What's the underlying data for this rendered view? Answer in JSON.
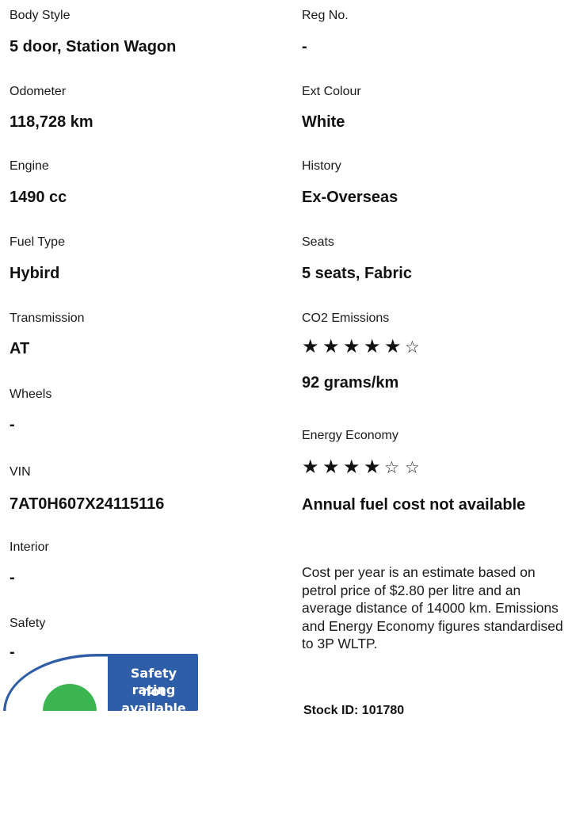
{
  "left": {
    "body_style": {
      "label": "Body Style",
      "value": "5 door, Station Wagon"
    },
    "odometer": {
      "label": "Odometer",
      "value": "118,728 km"
    },
    "engine": {
      "label": "Engine",
      "value": "1490 cc"
    },
    "fuel_type": {
      "label": "Fuel Type",
      "value": "Hybird"
    },
    "transmission": {
      "label": "Transmission",
      "value": "AT"
    },
    "wheels": {
      "label": "Wheels",
      "value": "-"
    },
    "vin": {
      "label": "VIN",
      "value": "7AT0H607X24115116"
    },
    "interior": {
      "label": "Interior",
      "value": "-"
    },
    "safety": {
      "label": "Safety",
      "value": "-",
      "badge_line1": "Safety rating",
      "badge_line2": "not available"
    }
  },
  "right": {
    "reg_no": {
      "label": "Reg No.",
      "value": "-"
    },
    "ext_colour": {
      "label": "Ext Colour",
      "value": "White"
    },
    "history": {
      "label": "History",
      "value": "Ex-Overseas"
    },
    "seats": {
      "label": "Seats",
      "value": "5 seats, Fabric"
    },
    "co2": {
      "label": "CO2 Emissions",
      "rating": 5,
      "max_rating": 6,
      "value": "92 grams/km"
    },
    "energy": {
      "label": "Energy Economy",
      "rating": 4,
      "max_rating": 6,
      "value": "Annual fuel cost not available"
    },
    "note": "Cost per year is an estimate based on petrol price of  $2.80 per litre and an average distance of 14000 km. Emissions and Energy Economy figures standardised to 3P WLTP.",
    "stock_id": "Stock ID: 101780"
  },
  "colors": {
    "badge_blue": "#2f5ea8",
    "badge_green": "#3cb551",
    "badge_border": "#2f5ea8",
    "text": "#111111"
  }
}
